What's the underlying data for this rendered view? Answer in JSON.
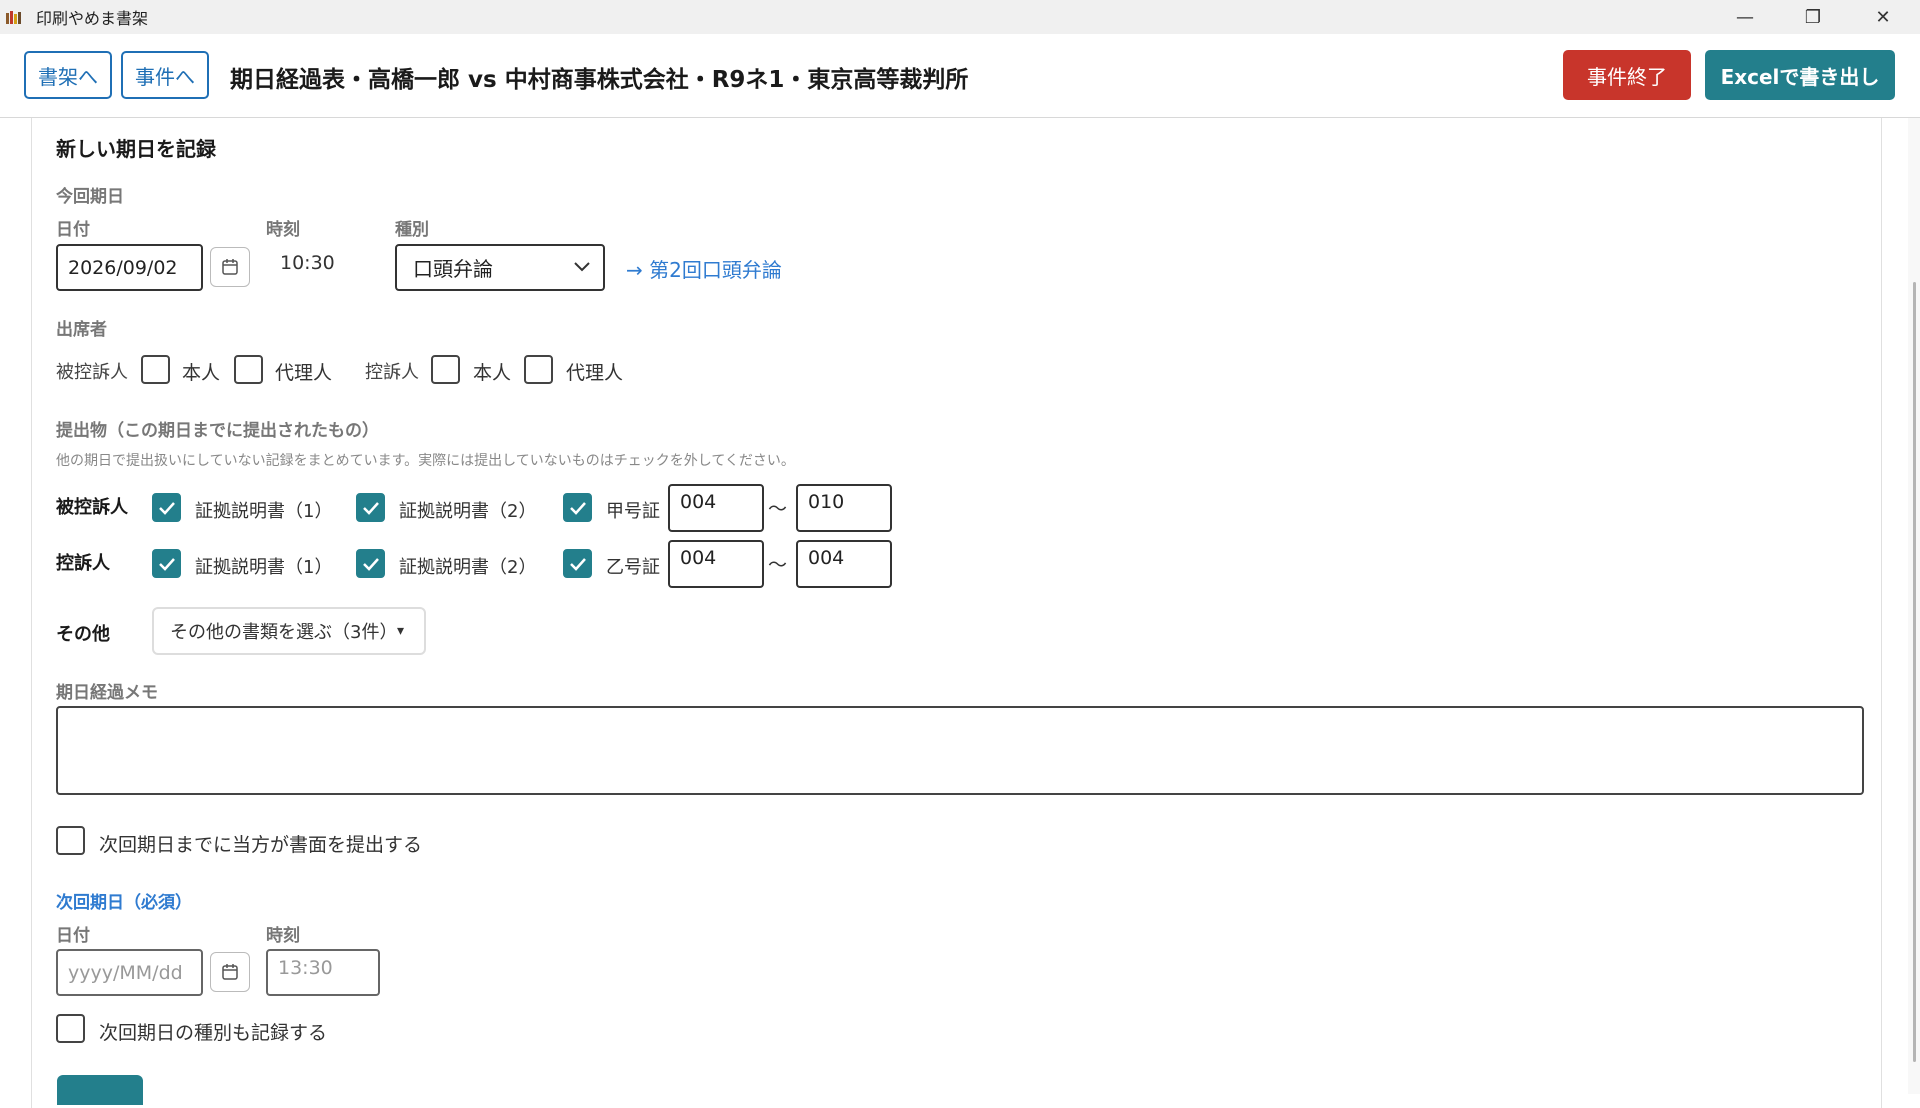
{
  "window": {
    "title": "印刷やめま書架",
    "minimize_glyph": "—",
    "maximize_glyph": "❐",
    "close_glyph": "✕"
  },
  "header": {
    "nav_shelf": "書架へ",
    "nav_case": "事件へ",
    "title": "期日経過表・高橋一郎 vs 中村商事株式会社・R9ネ1・東京高等裁判所",
    "end_case": "事件終了",
    "export_excel": "Excelで書き出し"
  },
  "form": {
    "section_title": "新しい期日を記録",
    "current_date_heading": "今回期日",
    "date_label": "日付",
    "date_value": "2026/09/02",
    "time_label": "時刻",
    "time_value": "10:30",
    "type_label": "種別",
    "type_value": "口頭弁論",
    "type_link": "→ 第2回口頭弁論",
    "attendees": {
      "heading": "出席者",
      "appellee_label": "被控訴人",
      "appellee_self": "本人",
      "appellee_agent": "代理人",
      "appellant_label": "控訴人",
      "appellant_self": "本人",
      "appellant_agent": "代理人"
    },
    "submissions": {
      "heading": "提出物（この期日までに提出されたもの）",
      "note": "他の期日で提出扱いにしていない記録をまとめています。実際には提出していないものはチェックを外してください。",
      "appellee": {
        "label": "被控訴人",
        "item1": "証拠説明書（1）",
        "item2": "証拠説明書（2）",
        "evidence": "甲号証",
        "from": "004",
        "to": "010"
      },
      "appellant": {
        "label": "控訴人",
        "item1": "証拠説明書（1）",
        "item2": "証拠説明書（2）",
        "evidence": "乙号証",
        "from": "004",
        "to": "004"
      },
      "range_sep": "～",
      "other_label": "その他",
      "other_select": "その他の書類を選ぶ（3件）",
      "other_arrow": "▾"
    },
    "memo_label": "期日経過メモ",
    "submit_by_next": "次回期日までに当方が書面を提出する",
    "next": {
      "heading": "次回期日（必須）",
      "date_label": "日付",
      "date_placeholder": "yyyy/MM/dd",
      "time_label": "時刻",
      "time_placeholder": "13:30",
      "record_type": "次回期日の種別も記録する"
    }
  }
}
